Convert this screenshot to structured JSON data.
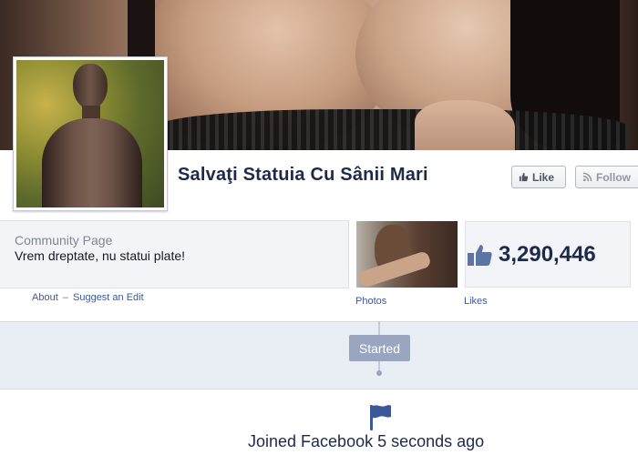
{
  "page": {
    "name": "Salvaţi Statuia Cu Sânii Mari",
    "category": "Community Page",
    "description": "Vrem dreptate, nu statui plate!"
  },
  "actions": {
    "like_label": "Like",
    "follow_label": "Follow"
  },
  "about_links": {
    "about": "About",
    "separator": "–",
    "suggest_edit": "Suggest an Edit"
  },
  "photos": {
    "label": "Photos"
  },
  "likes": {
    "count": "3,290,446",
    "label": "Likes"
  },
  "timeline": {
    "started_label": "Started",
    "event_text": "Joined Facebook 5 seconds ago"
  },
  "icons": [
    "thumbs-up-icon",
    "rss-icon",
    "flag-icon"
  ],
  "colors": {
    "link": "#3b5998",
    "title": "#1d2a4a",
    "pill": "#9aa6bf"
  }
}
